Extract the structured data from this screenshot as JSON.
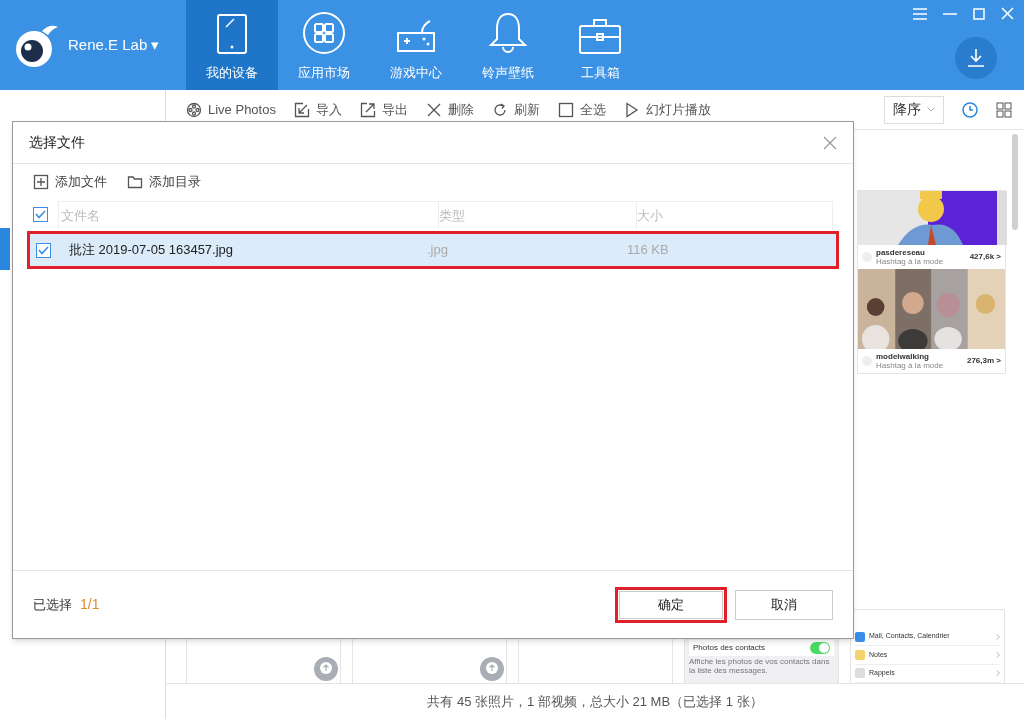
{
  "app": {
    "brand": "Rene.E Lab ▾"
  },
  "nav_tabs": [
    {
      "label": "我的设备",
      "selected": true
    },
    {
      "label": "应用市场",
      "selected": false
    },
    {
      "label": "游戏中心",
      "selected": false
    },
    {
      "label": "铃声壁纸",
      "selected": false
    },
    {
      "label": "工具箱",
      "selected": false
    }
  ],
  "toolbar": {
    "items": [
      {
        "label": "Live Photos"
      },
      {
        "label": "导入"
      },
      {
        "label": "导出"
      },
      {
        "label": "删除"
      },
      {
        "label": "刷新"
      },
      {
        "label": "全选"
      },
      {
        "label": "幻灯片播放"
      }
    ],
    "sort": "降序"
  },
  "gallery": {
    "top_thumb": {
      "rows": [
        {
          "name": "pasdereseau",
          "sub": "Hashtag à la mode",
          "count": "427,6k >"
        },
        {
          "name": "modelwalking",
          "sub": "Hashtag à la mode",
          "count": "276,3m >"
        }
      ]
    },
    "settings_thumb": {
      "toggle_label": "Photos des contacts",
      "toggle_on": true,
      "note": "Affiche les photos de vos contacts dans la liste des messages."
    },
    "menu_thumb": {
      "items": [
        "Mail, Contacts, Calendrier",
        "Notes",
        "Rappels"
      ]
    }
  },
  "status_bar": "共有 45 张照片，1 部视频，总大小 21 MB（已选择 1 张）",
  "dialog": {
    "title": "选择文件",
    "actions": [
      "添加文件",
      "添加目录"
    ],
    "columns": [
      "文件名",
      "类型",
      "大小"
    ],
    "all_checked": true,
    "rows": [
      {
        "name": "批注 2019-07-05 163457.jpg",
        "type": ".jpg",
        "size": "116 KB",
        "checked": true,
        "selected": true
      }
    ],
    "selected_label": "已选择",
    "selected_count": "1/1",
    "buttons": [
      {
        "label": "确定",
        "kind": "primary"
      },
      {
        "label": "取消",
        "kind": "secondary"
      }
    ]
  }
}
